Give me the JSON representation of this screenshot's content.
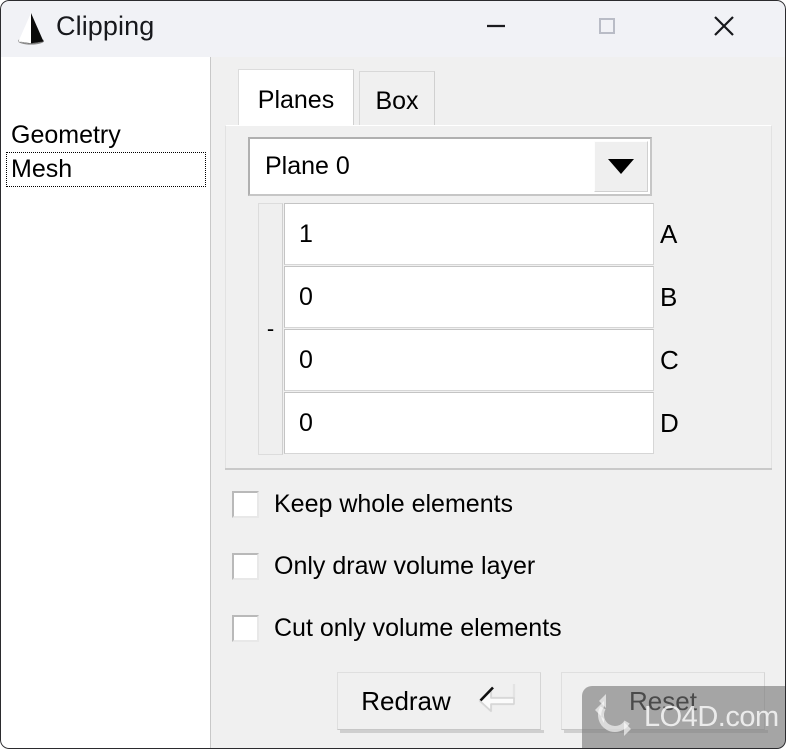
{
  "window": {
    "title": "Clipping",
    "icon": "cone-icon",
    "controls": {
      "minimize": "minimize-icon",
      "maximize": "maximize-icon",
      "close": "close-icon"
    }
  },
  "sidebar": {
    "items": [
      {
        "label": "Geometry",
        "selected": false
      },
      {
        "label": "Mesh",
        "selected": true
      }
    ]
  },
  "tabs": [
    {
      "label": "Planes",
      "active": true
    },
    {
      "label": "Box",
      "active": false
    }
  ],
  "plane_panel": {
    "combo": {
      "value": "Plane 0",
      "arrow_icon": "chevron-down-icon"
    },
    "scale_strip": {
      "value": "-"
    },
    "coefficients": [
      {
        "label": "A",
        "value": "1"
      },
      {
        "label": "B",
        "value": "0"
      },
      {
        "label": "C",
        "value": "0"
      },
      {
        "label": "D",
        "value": "0"
      }
    ]
  },
  "checkboxes": [
    {
      "label": "Keep whole elements",
      "checked": false
    },
    {
      "label": "Only draw volume layer",
      "checked": false
    },
    {
      "label": "Cut only volume elements",
      "checked": false
    }
  ],
  "buttons": {
    "redraw": {
      "label": "Redraw",
      "icon": "return-key-icon"
    },
    "reset": {
      "label": "Reset"
    }
  },
  "watermark": {
    "text": "LO4D.com",
    "icon": "refresh-arrows-icon"
  },
  "colors": {
    "window_bg": "#f0f0f0",
    "titlebar_bg": "#f1f2f6",
    "sidebar_bg": "#ffffff",
    "text": "#000000",
    "frame": "#2b2b2e"
  }
}
